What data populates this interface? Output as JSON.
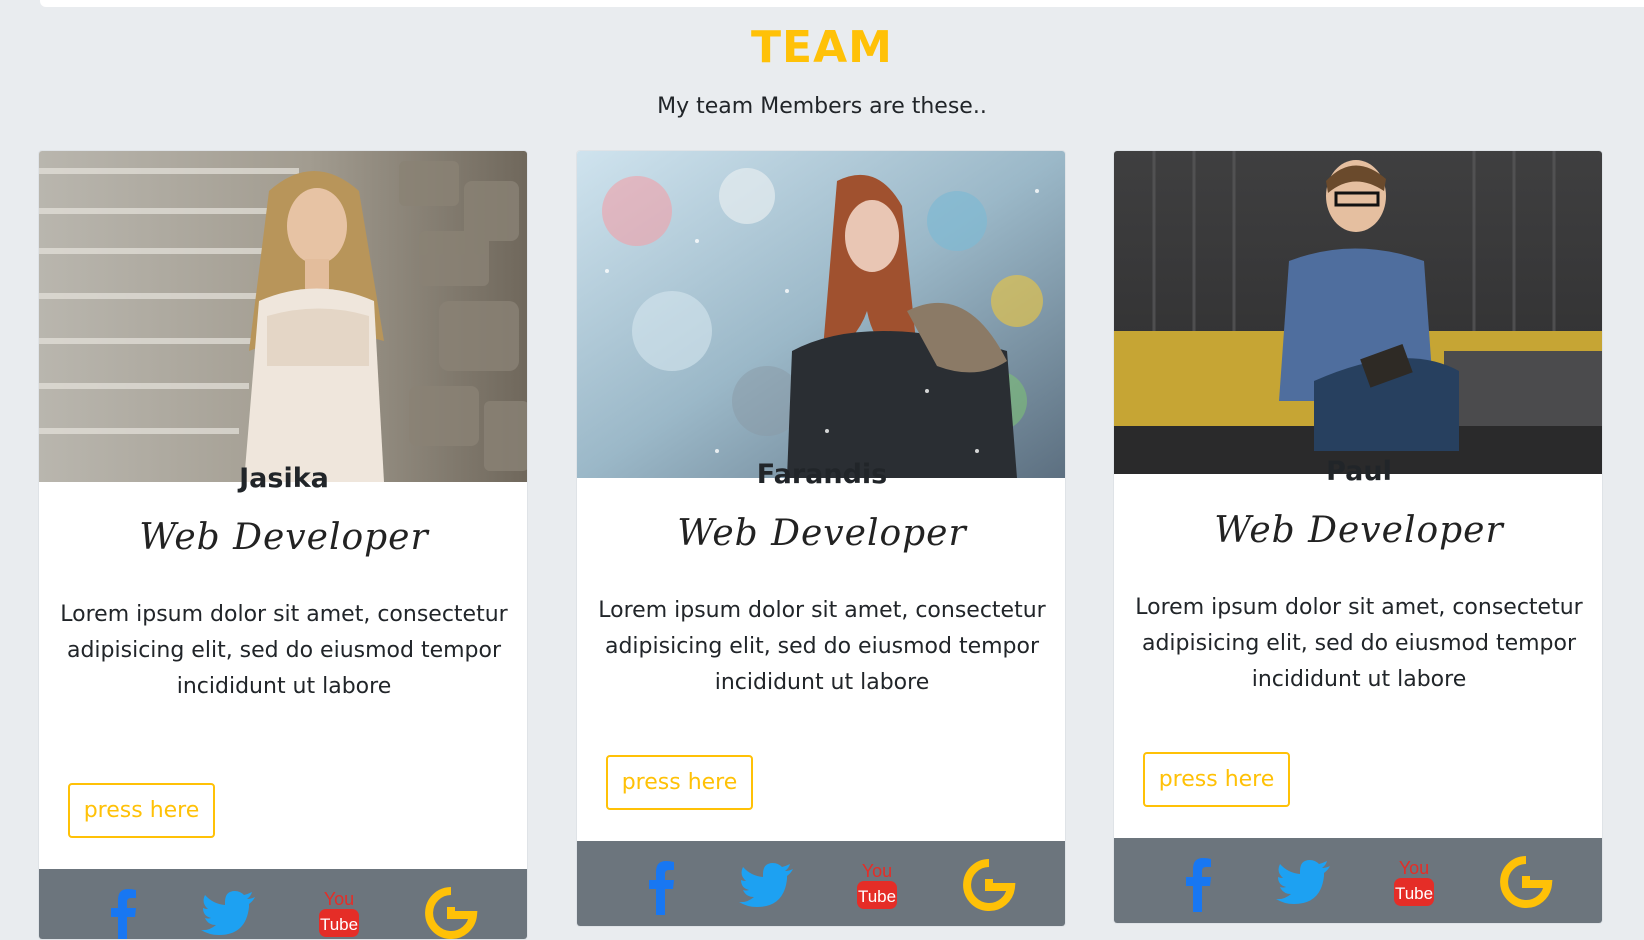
{
  "section": {
    "title": "TEAM",
    "subtitle": "My team Members are these.."
  },
  "colors": {
    "accent": "#ffc107",
    "background": "#e9ecef",
    "footer": "#6c757d",
    "facebook": "#1877f2",
    "twitter": "#1da1f2",
    "youtube": "#e52d27",
    "google": "#ffc107"
  },
  "members": [
    {
      "name": "Jasika",
      "role": "Web Developer",
      "description": "Lorem ipsum dolor sit amet, consectetur adipisicing elit, sed do eiusmod tempor incididunt ut labore",
      "button_label": "press here",
      "photo_subject": "woman-on-stone-steps",
      "social": [
        "facebook-icon",
        "twitter-icon",
        "youtube-icon",
        "google-icon"
      ]
    },
    {
      "name": "Farandis",
      "role": "Web Developer",
      "description": "Lorem ipsum dolor sit amet, consectetur adipisicing elit, sed do eiusmod tempor incididunt ut labore",
      "button_label": "press here",
      "photo_subject": "woman-in-snow",
      "social": [
        "facebook-icon",
        "twitter-icon",
        "youtube-icon",
        "google-icon"
      ]
    },
    {
      "name": "Paul",
      "role": "Web Developer",
      "description": "Lorem ipsum dolor sit amet, consectetur adipisicing elit, sed do eiusmod tempor incididunt ut labore",
      "button_label": "press here",
      "photo_subject": "man-writing-on-couch",
      "social": [
        "facebook-icon",
        "twitter-icon",
        "youtube-icon",
        "google-icon"
      ]
    }
  ],
  "youtube_icon_text": {
    "top": "You",
    "bottom": "Tube"
  }
}
